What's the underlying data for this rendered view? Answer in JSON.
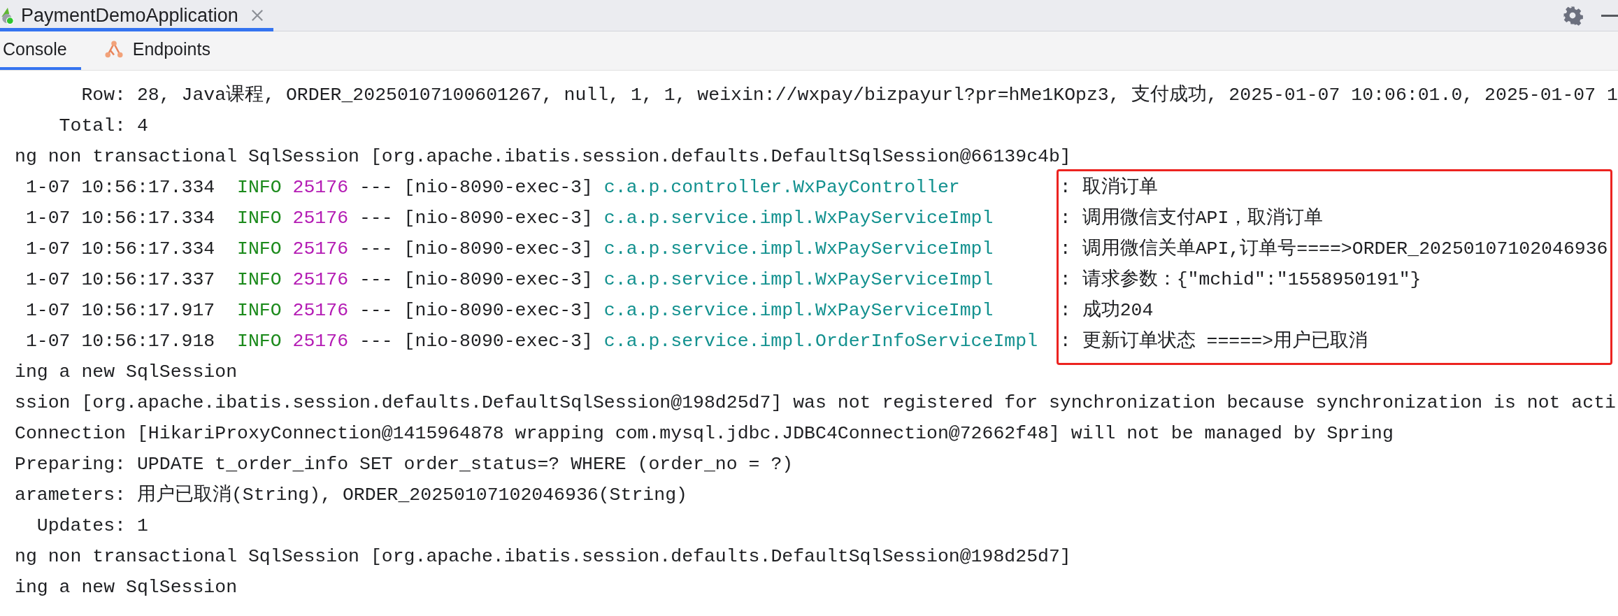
{
  "run_tab": {
    "title": "PaymentDemoApplication",
    "selected": true
  },
  "tool_tabs": [
    {
      "label": "Console",
      "selected": true
    },
    {
      "label": "Endpoints",
      "selected": false
    }
  ],
  "console": {
    "lines": [
      {
        "kind": "plain",
        "text": "      Row: 28, Java课程, ORDER_20250107100601267, null, 1, 1, weixin://wxpay/bizpayurl?pr=hMe1KOpz3, 支付成功, 2025-01-07 10:06:01.0, 2025-01-07 1"
      },
      {
        "kind": "plain",
        "text": "    Total: 4"
      },
      {
        "kind": "plain",
        "text": "ng non transactional SqlSession [org.apache.ibatis.session.defaults.DefaultSqlSession@66139c4b]"
      },
      {
        "kind": "log",
        "time": "1-07 10:56:17.334",
        "level": "INFO",
        "pid": "25176",
        "thread": "--- [nio-8090-exec-3]",
        "logger": "c.a.p.controller.WxPayController",
        "message": ": 取消订单"
      },
      {
        "kind": "log",
        "time": "1-07 10:56:17.334",
        "level": "INFO",
        "pid": "25176",
        "thread": "--- [nio-8090-exec-3]",
        "logger": "c.a.p.service.impl.WxPayServiceImpl",
        "message": ": 调用微信支付API，取消订单"
      },
      {
        "kind": "log",
        "time": "1-07 10:56:17.334",
        "level": "INFO",
        "pid": "25176",
        "thread": "--- [nio-8090-exec-3]",
        "logger": "c.a.p.service.impl.WxPayServiceImpl",
        "message": ": 调用微信关单API,订单号====>ORDER_20250107102046936"
      },
      {
        "kind": "log",
        "time": "1-07 10:56:17.337",
        "level": "INFO",
        "pid": "25176",
        "thread": "--- [nio-8090-exec-3]",
        "logger": "c.a.p.service.impl.WxPayServiceImpl",
        "message": ": 请求参数：{\"mchid\":\"1558950191\"}"
      },
      {
        "kind": "log",
        "time": "1-07 10:56:17.917",
        "level": "INFO",
        "pid": "25176",
        "thread": "--- [nio-8090-exec-3]",
        "logger": "c.a.p.service.impl.WxPayServiceImpl",
        "message": ": 成功204"
      },
      {
        "kind": "log",
        "time": "1-07 10:56:17.918",
        "level": "INFO",
        "pid": "25176",
        "thread": "--- [nio-8090-exec-3]",
        "logger": "c.a.p.service.impl.OrderInfoServiceImpl",
        "message": ": 更新订单状态 =====>用户已取消"
      },
      {
        "kind": "plain",
        "text": "ing a new SqlSession"
      },
      {
        "kind": "plain",
        "text": "ssion [org.apache.ibatis.session.defaults.DefaultSqlSession@198d25d7] was not registered for synchronization because synchronization is not acti"
      },
      {
        "kind": "plain",
        "text": "Connection [HikariProxyConnection@1415964878 wrapping com.mysql.jdbc.JDBC4Connection@72662f48] will not be managed by Spring"
      },
      {
        "kind": "plain",
        "text": "Preparing: UPDATE t_order_info SET order_status=? WHERE (order_no = ?)"
      },
      {
        "kind": "plain",
        "text": "arameters: 用户已取消(String), ORDER_20250107102046936(String)"
      },
      {
        "kind": "plain",
        "text": "  Updates: 1"
      },
      {
        "kind": "plain",
        "text": "ng non transactional SqlSession [org.apache.ibatis.session.defaults.DefaultSqlSession@198d25d7]"
      },
      {
        "kind": "plain",
        "text": "ing a new SqlSession"
      }
    ]
  }
}
